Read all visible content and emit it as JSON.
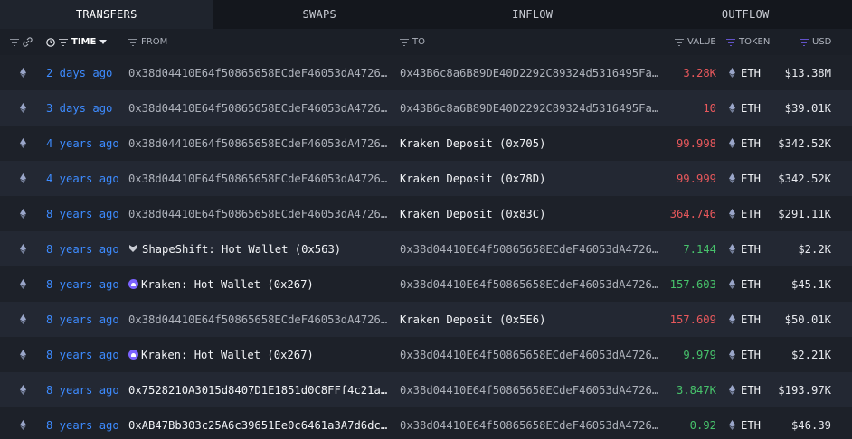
{
  "tabs": [
    "TRANSFERS",
    "SWAPS",
    "INFLOW",
    "OUTFLOW"
  ],
  "active_tab": 0,
  "columns": {
    "time": "TIME",
    "from": "FROM",
    "to": "TO",
    "value": "VALUE",
    "token": "TOKEN",
    "usd": "USD"
  },
  "colors": {
    "time": "#3d8bff",
    "out": "#e8585c",
    "in": "#47c26b",
    "accent": "#7b63ff"
  },
  "rows": [
    {
      "time": "2 days ago",
      "from": "0x38d04410E64f50865658ECdeF46053dA4726…",
      "from_type": "address",
      "to": "0x43B6c8a6B89DE40D2292C89324d5316495Fa…",
      "to_type": "address",
      "value": "3.28K",
      "dir": "out",
      "token": "ETH",
      "usd": "$13.38M"
    },
    {
      "time": "3 days ago",
      "from": "0x38d04410E64f50865658ECdeF46053dA4726…",
      "from_type": "address",
      "to": "0x43B6c8a6B89DE40D2292C89324d5316495Fa…",
      "to_type": "address",
      "value": "10",
      "dir": "out",
      "token": "ETH",
      "usd": "$39.01K"
    },
    {
      "time": "4 years ago",
      "from": "0x38d04410E64f50865658ECdeF46053dA4726…",
      "from_type": "address",
      "to": "Kraken Deposit (0x705)",
      "to_type": "entity",
      "value": "99.998",
      "dir": "out",
      "token": "ETH",
      "usd": "$342.52K"
    },
    {
      "time": "4 years ago",
      "from": "0x38d04410E64f50865658ECdeF46053dA4726…",
      "from_type": "address",
      "to": "Kraken Deposit (0x78D)",
      "to_type": "entity",
      "value": "99.999",
      "dir": "out",
      "token": "ETH",
      "usd": "$342.52K"
    },
    {
      "time": "8 years ago",
      "from": "0x38d04410E64f50865658ECdeF46053dA4726…",
      "from_type": "address",
      "to": "Kraken Deposit (0x83C)",
      "to_type": "entity",
      "value": "364.746",
      "dir": "out",
      "token": "ETH",
      "usd": "$291.11K"
    },
    {
      "time": "8 years ago",
      "from": "ShapeShift: Hot Wallet (0x563)",
      "from_type": "shapeshift",
      "to": "0x38d04410E64f50865658ECdeF46053dA4726…",
      "to_type": "address",
      "value": "7.144",
      "dir": "in",
      "token": "ETH",
      "usd": "$2.2K"
    },
    {
      "time": "8 years ago",
      "from": "Kraken: Hot Wallet (0x267)",
      "from_type": "kraken",
      "to": "0x38d04410E64f50865658ECdeF46053dA4726…",
      "to_type": "address",
      "value": "157.603",
      "dir": "in",
      "token": "ETH",
      "usd": "$45.1K"
    },
    {
      "time": "8 years ago",
      "from": "0x38d04410E64f50865658ECdeF46053dA4726…",
      "from_type": "address",
      "to": "Kraken Deposit (0x5E6)",
      "to_type": "entity",
      "value": "157.609",
      "dir": "out",
      "token": "ETH",
      "usd": "$50.01K"
    },
    {
      "time": "8 years ago",
      "from": "Kraken: Hot Wallet (0x267)",
      "from_type": "kraken",
      "to": "0x38d04410E64f50865658ECdeF46053dA4726…",
      "to_type": "address",
      "value": "9.979",
      "dir": "in",
      "token": "ETH",
      "usd": "$2.21K"
    },
    {
      "time": "8 years ago",
      "from": "0x7528210A3015d8407D1E1851d0C8FFf4c21a…",
      "from_type": "entity",
      "to": "0x38d04410E64f50865658ECdeF46053dA4726…",
      "to_type": "address",
      "value": "3.847K",
      "dir": "in",
      "token": "ETH",
      "usd": "$193.97K"
    },
    {
      "time": "8 years ago",
      "from": "0xAB47Bb303c25A6c39651Ee0c6461a3A7d6dc…",
      "from_type": "entity",
      "to": "0x38d04410E64f50865658ECdeF46053dA4726…",
      "to_type": "address",
      "value": "0.92",
      "dir": "in",
      "token": "ETH",
      "usd": "$46.39"
    }
  ]
}
